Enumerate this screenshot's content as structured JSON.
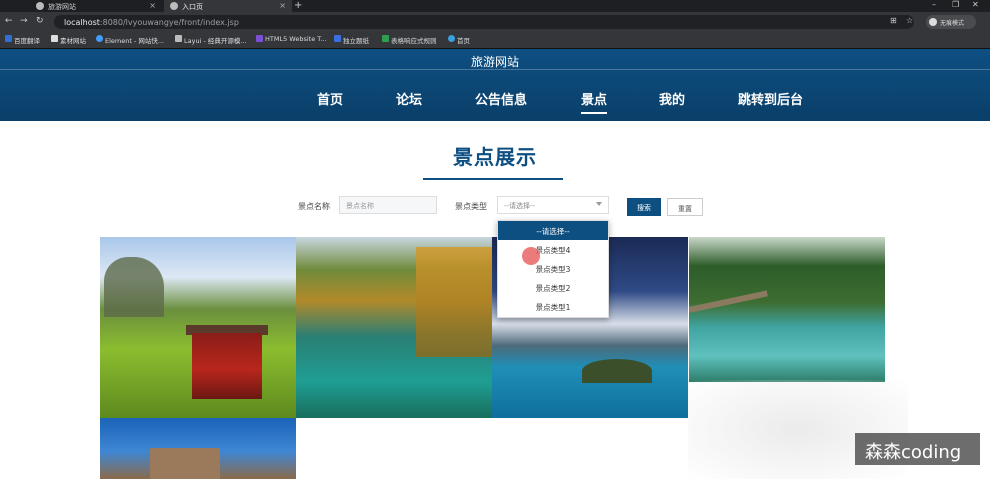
{
  "browser": {
    "tabs": [
      {
        "label": "旅游网站",
        "active": false
      },
      {
        "label": "入口页",
        "active": true
      }
    ],
    "url_host": "localhost",
    "url_rest": ":8080/lvyouwangye/front/index.jsp",
    "profile_label": "无痕模式",
    "bookmarks": [
      "百度翻译",
      "素材网站",
      "Element - 网站快...",
      "Layui - 经典开源模...",
      "HTML5 Website T...",
      "独立题纸",
      "表格响应式规则",
      "首页"
    ]
  },
  "site": {
    "title": "旅游网站",
    "nav": [
      {
        "label": "首页",
        "active": false
      },
      {
        "label": "论坛",
        "active": false
      },
      {
        "label": "公告信息",
        "active": false
      },
      {
        "label": "景点",
        "active": true
      },
      {
        "label": "我的",
        "active": false
      },
      {
        "label": "跳转到后台",
        "active": false
      }
    ]
  },
  "page": {
    "section_title": "景点展示",
    "search": {
      "name_label": "景点名称",
      "name_placeholder": "景点名称",
      "type_label": "景点类型",
      "type_value": "--请选择--",
      "search_button": "搜索",
      "reset_button": "重置"
    },
    "dropdown_options": [
      "--请选择--",
      "景点类型4",
      "景点类型3",
      "景点类型2",
      "景点类型1"
    ]
  },
  "watermark": "森森coding",
  "colors": {
    "brand": "#0e4f82",
    "header_dark": "#0a3f69",
    "cursor": "#e65050"
  }
}
